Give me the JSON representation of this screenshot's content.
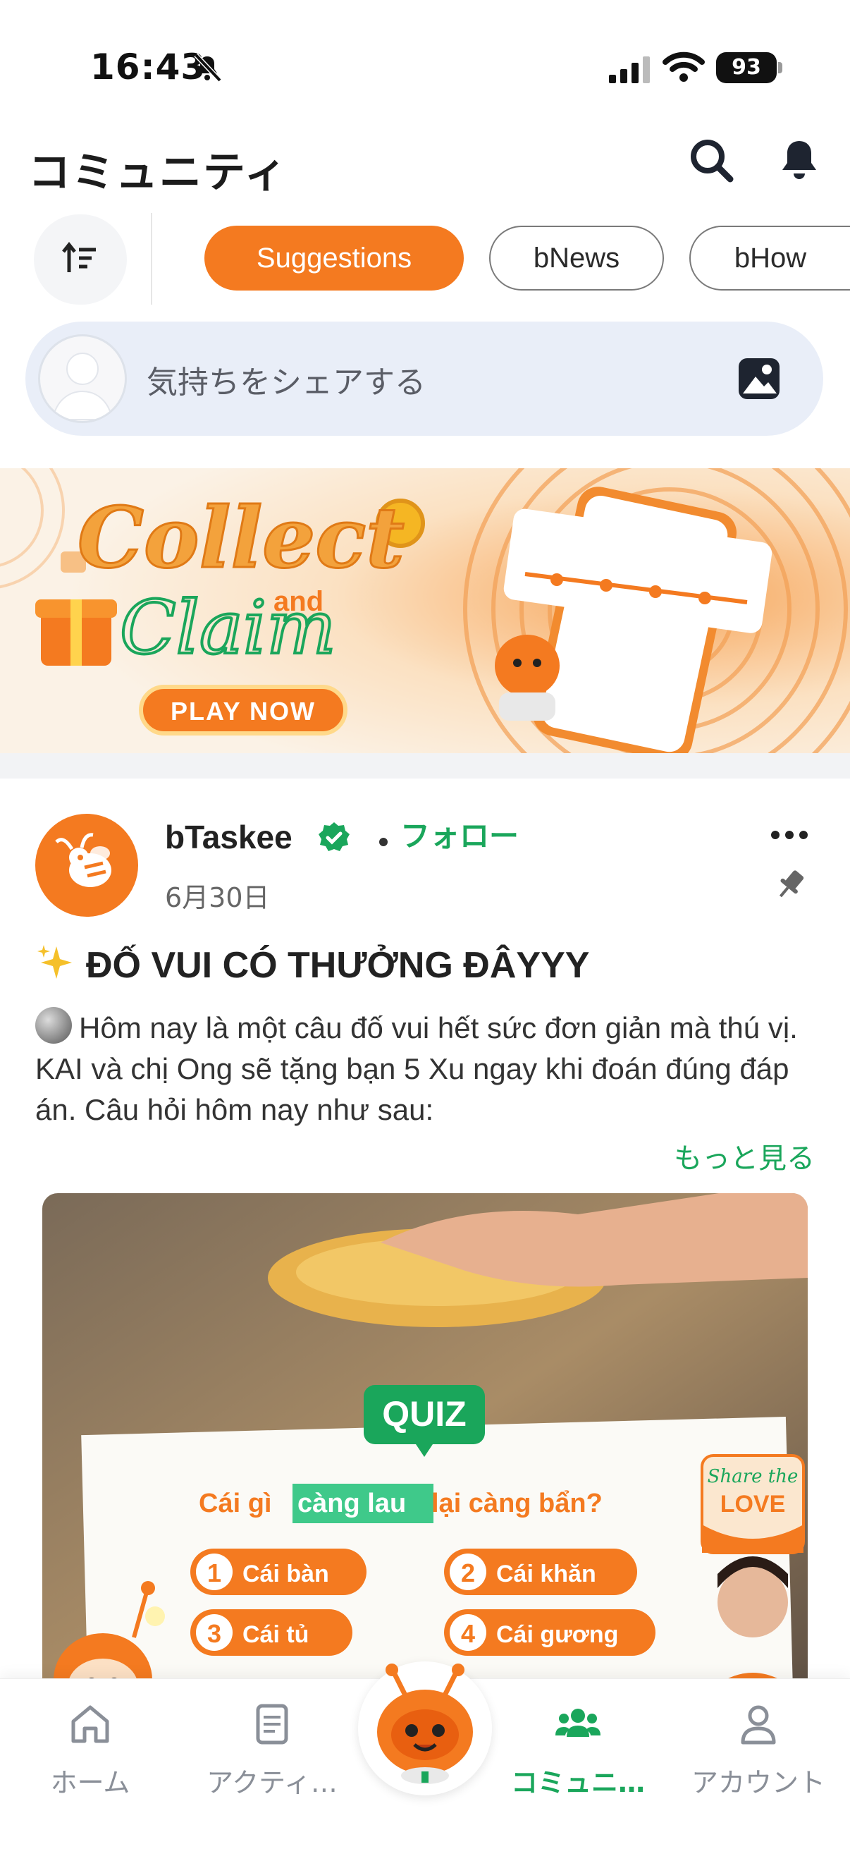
{
  "status_bar": {
    "time": "16:43",
    "battery": "93"
  },
  "header": {
    "title": "コミュニティ"
  },
  "filters": {
    "chips": [
      "Suggestions",
      "bNews",
      "bHow"
    ]
  },
  "composer": {
    "placeholder": "気持ちをシェアする"
  },
  "banner": {
    "line1": "Collect",
    "line2": "and",
    "line3": "Claim",
    "cta": "PLAY NOW"
  },
  "post": {
    "author": "bTaskee",
    "follow": "フォロー",
    "date": "6月30日",
    "title": "ĐỐ VUI CÓ THƯỞNG ĐÂYYY",
    "body": "Hôm nay là một câu đố vui hết sức đơn giản mà thú vị. KAI và chị Ong sẽ tặng bạn 5 Xu ngay khi đoán đúng đáp án. Câu hỏi hôm nay như sau:",
    "see_more": "もっと見る",
    "image": {
      "badge": "QUIZ",
      "question_pre": "Cái gì ",
      "question_hl": "càng lau",
      "question_post": " lại càng bẩn?",
      "options": [
        {
          "num": "1",
          "text": "Cái bàn"
        },
        {
          "num": "2",
          "text": "Cái khăn"
        },
        {
          "num": "3",
          "text": "Cái tủ"
        },
        {
          "num": "4",
          "text": "Cái gương"
        }
      ],
      "sticker_line1": "Share the",
      "sticker_line2": "LOVE"
    }
  },
  "nav": {
    "items": [
      {
        "label": "ホーム",
        "icon": "home-icon"
      },
      {
        "label": "アクティ…",
        "icon": "activity-icon"
      },
      {
        "label": "コミュニ…",
        "icon": "community-icon"
      },
      {
        "label": "アカウント",
        "icon": "account-icon"
      }
    ]
  },
  "colors": {
    "accent": "#f47a20",
    "green": "#1aa65b"
  }
}
